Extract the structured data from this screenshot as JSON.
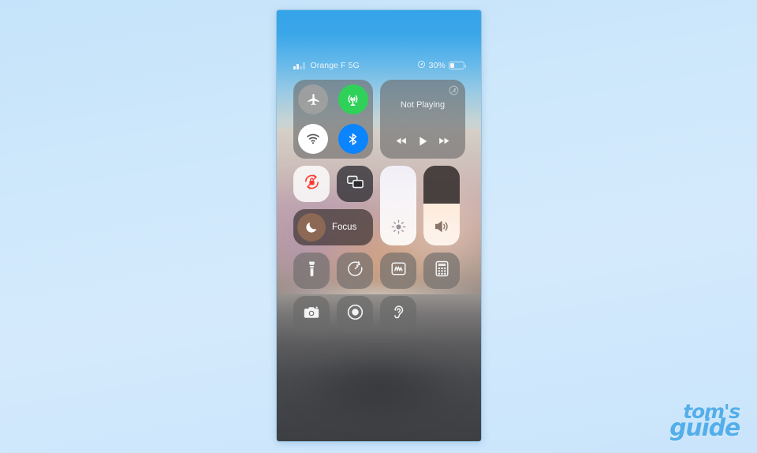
{
  "page": {
    "background_color": "#cfe8fb",
    "watermark_color": "#53aeea"
  },
  "watermark": {
    "line1": "tom's",
    "line2": "guide"
  },
  "phone": {
    "status_bar": {
      "signal_icon": "cellular-bars-icon",
      "carrier": "Orange F 5G",
      "location_icon": "location-arrow-icon",
      "battery_percent": "30%",
      "battery_level": 30,
      "battery_icon": "battery-icon"
    },
    "control_center": {
      "connectivity": {
        "module_name": "connectivity-module",
        "toggles": [
          {
            "name": "airplane-mode",
            "icon": "airplane-icon",
            "state": "off",
            "color": "#a0a0a0"
          },
          {
            "name": "cellular-data",
            "icon": "cellular-antenna-icon",
            "state": "on",
            "color": "#30d158"
          },
          {
            "name": "wifi",
            "icon": "wifi-icon",
            "state": "on",
            "color": "#ffffff"
          },
          {
            "name": "bluetooth",
            "icon": "bluetooth-icon",
            "state": "on",
            "color": "#0a84ff"
          }
        ]
      },
      "media": {
        "module_name": "media-playback-module",
        "status_text": "Not Playing",
        "airplay_icon": "airplay-icon",
        "controls": [
          {
            "name": "rewind-button",
            "icon": "rewind-icon"
          },
          {
            "name": "play-button",
            "icon": "play-icon"
          },
          {
            "name": "fast-forward-button",
            "icon": "fast-forward-icon"
          }
        ]
      },
      "tiles": {
        "rotation_lock": {
          "name": "rotation-lock",
          "icon": "rotation-lock-icon",
          "state": "on",
          "color": "#ff3b30"
        },
        "screen_mirroring": {
          "name": "screen-mirroring",
          "icon": "screen-mirroring-icon",
          "state": "off"
        },
        "focus": {
          "name": "focus",
          "label": "Focus",
          "icon": "moon-icon",
          "state": "off"
        }
      },
      "sliders": [
        {
          "name": "brightness-slider",
          "icon": "brightness-icon",
          "value": 100
        },
        {
          "name": "volume-slider",
          "icon": "volume-icon",
          "value": 52
        }
      ],
      "utility_row_1": [
        {
          "name": "flashlight",
          "icon": "flashlight-icon"
        },
        {
          "name": "timer",
          "icon": "timer-icon"
        },
        {
          "name": "voice-memos",
          "icon": "voice-memos-icon"
        },
        {
          "name": "calculator",
          "icon": "calculator-icon"
        }
      ],
      "utility_row_2": [
        {
          "name": "camera",
          "icon": "camera-icon"
        },
        {
          "name": "screen-recording",
          "icon": "screen-record-icon"
        },
        {
          "name": "hearing",
          "icon": "ear-icon"
        }
      ]
    }
  }
}
